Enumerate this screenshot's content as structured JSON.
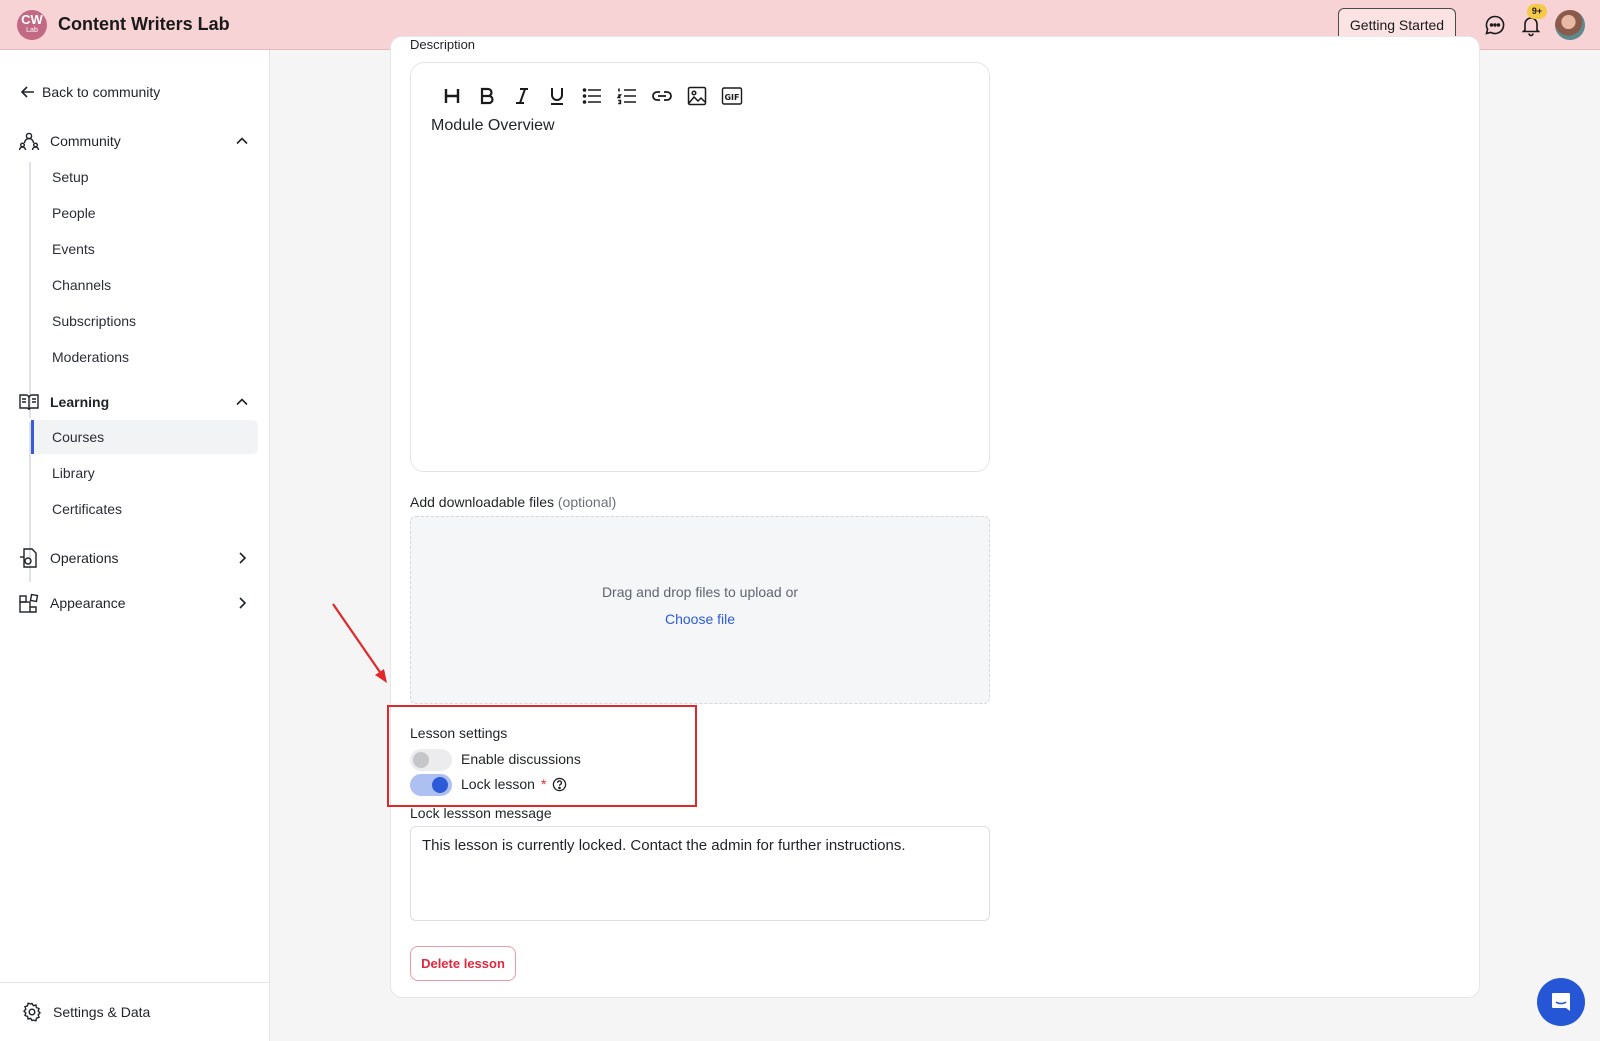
{
  "header": {
    "logo_text": "CW",
    "logo_sub": "Lab",
    "app_title": "Content Writers Lab",
    "getting_started_label": "Getting Started",
    "notification_badge": "9+",
    "icons": [
      "chat-icon",
      "bell-icon"
    ]
  },
  "sidebar": {
    "back_label": "Back to community",
    "sections": [
      {
        "label": "Community",
        "icon": "community-icon",
        "expanded": true,
        "items": [
          "Setup",
          "People",
          "Events",
          "Channels",
          "Subscriptions",
          "Moderations"
        ]
      },
      {
        "label": "Learning",
        "icon": "book-icon",
        "expanded": true,
        "items": [
          "Courses",
          "Library",
          "Certificates"
        ],
        "active_item": "Courses"
      },
      {
        "label": "Operations",
        "icon": "operations-icon",
        "expanded": false
      },
      {
        "label": "Appearance",
        "icon": "appearance-icon",
        "expanded": false
      }
    ],
    "settings_label": "Settings & Data"
  },
  "main": {
    "description_label": "Description",
    "editor": {
      "toolbar": [
        "heading",
        "bold",
        "italic",
        "underline",
        "bullet-list",
        "numbered-list",
        "link",
        "image",
        "gif"
      ],
      "content": "Module Overview"
    },
    "files": {
      "label": "Add downloadable files",
      "optional": "(optional)",
      "drop_text": "Drag and drop files to upload or",
      "choose_file": "Choose file"
    },
    "lesson_settings": {
      "title": "Lesson settings",
      "enable_discussions_label": "Enable discussions",
      "enable_discussions_on": false,
      "lock_lesson_label": "Lock lesson",
      "required_mark": "*",
      "lock_lesson_on": true
    },
    "lock_message": {
      "label": "Lock lessson message",
      "value": "This lesson is currently locked. Contact the admin for further instructions."
    },
    "delete_label": "Delete lesson"
  },
  "colors": {
    "topbar": "#f7d3d5",
    "accent": "#2d5bd7",
    "danger": "#e0283f",
    "annotation": "#e0282a"
  }
}
